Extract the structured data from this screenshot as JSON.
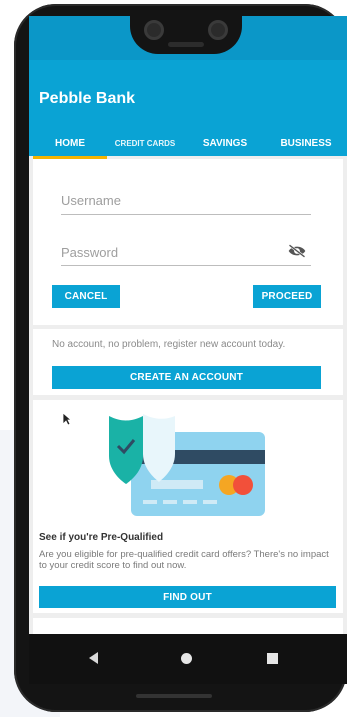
{
  "app": {
    "title": "Pebble Bank"
  },
  "tabs": [
    {
      "label": "HOME"
    },
    {
      "label": "CREDIT CARDS"
    },
    {
      "label": "SAVINGS"
    },
    {
      "label": "BUSINESS"
    }
  ],
  "login": {
    "username_placeholder": "Username",
    "password_placeholder": "Password",
    "cancel_label": "CANCEL",
    "proceed_label": "PROCEED"
  },
  "register": {
    "message": "No account, no problem, register new account today.",
    "create_label": "CREATE AN ACCOUNT"
  },
  "promo": {
    "title": "See if you're Pre-Qualified",
    "body": "Are you eligible for pre-qualified credit card offers? There's no impact to your credit score to find out now.",
    "cta_label": "FIND OUT"
  },
  "icons": {
    "eye": "eye-off-icon",
    "back": "back-icon",
    "home": "home-icon",
    "recent": "recent-apps-icon"
  },
  "colors": {
    "primary": "#0aa3d4",
    "status_bar": "#0b97c8",
    "tab_indicator": "#f4b400"
  }
}
